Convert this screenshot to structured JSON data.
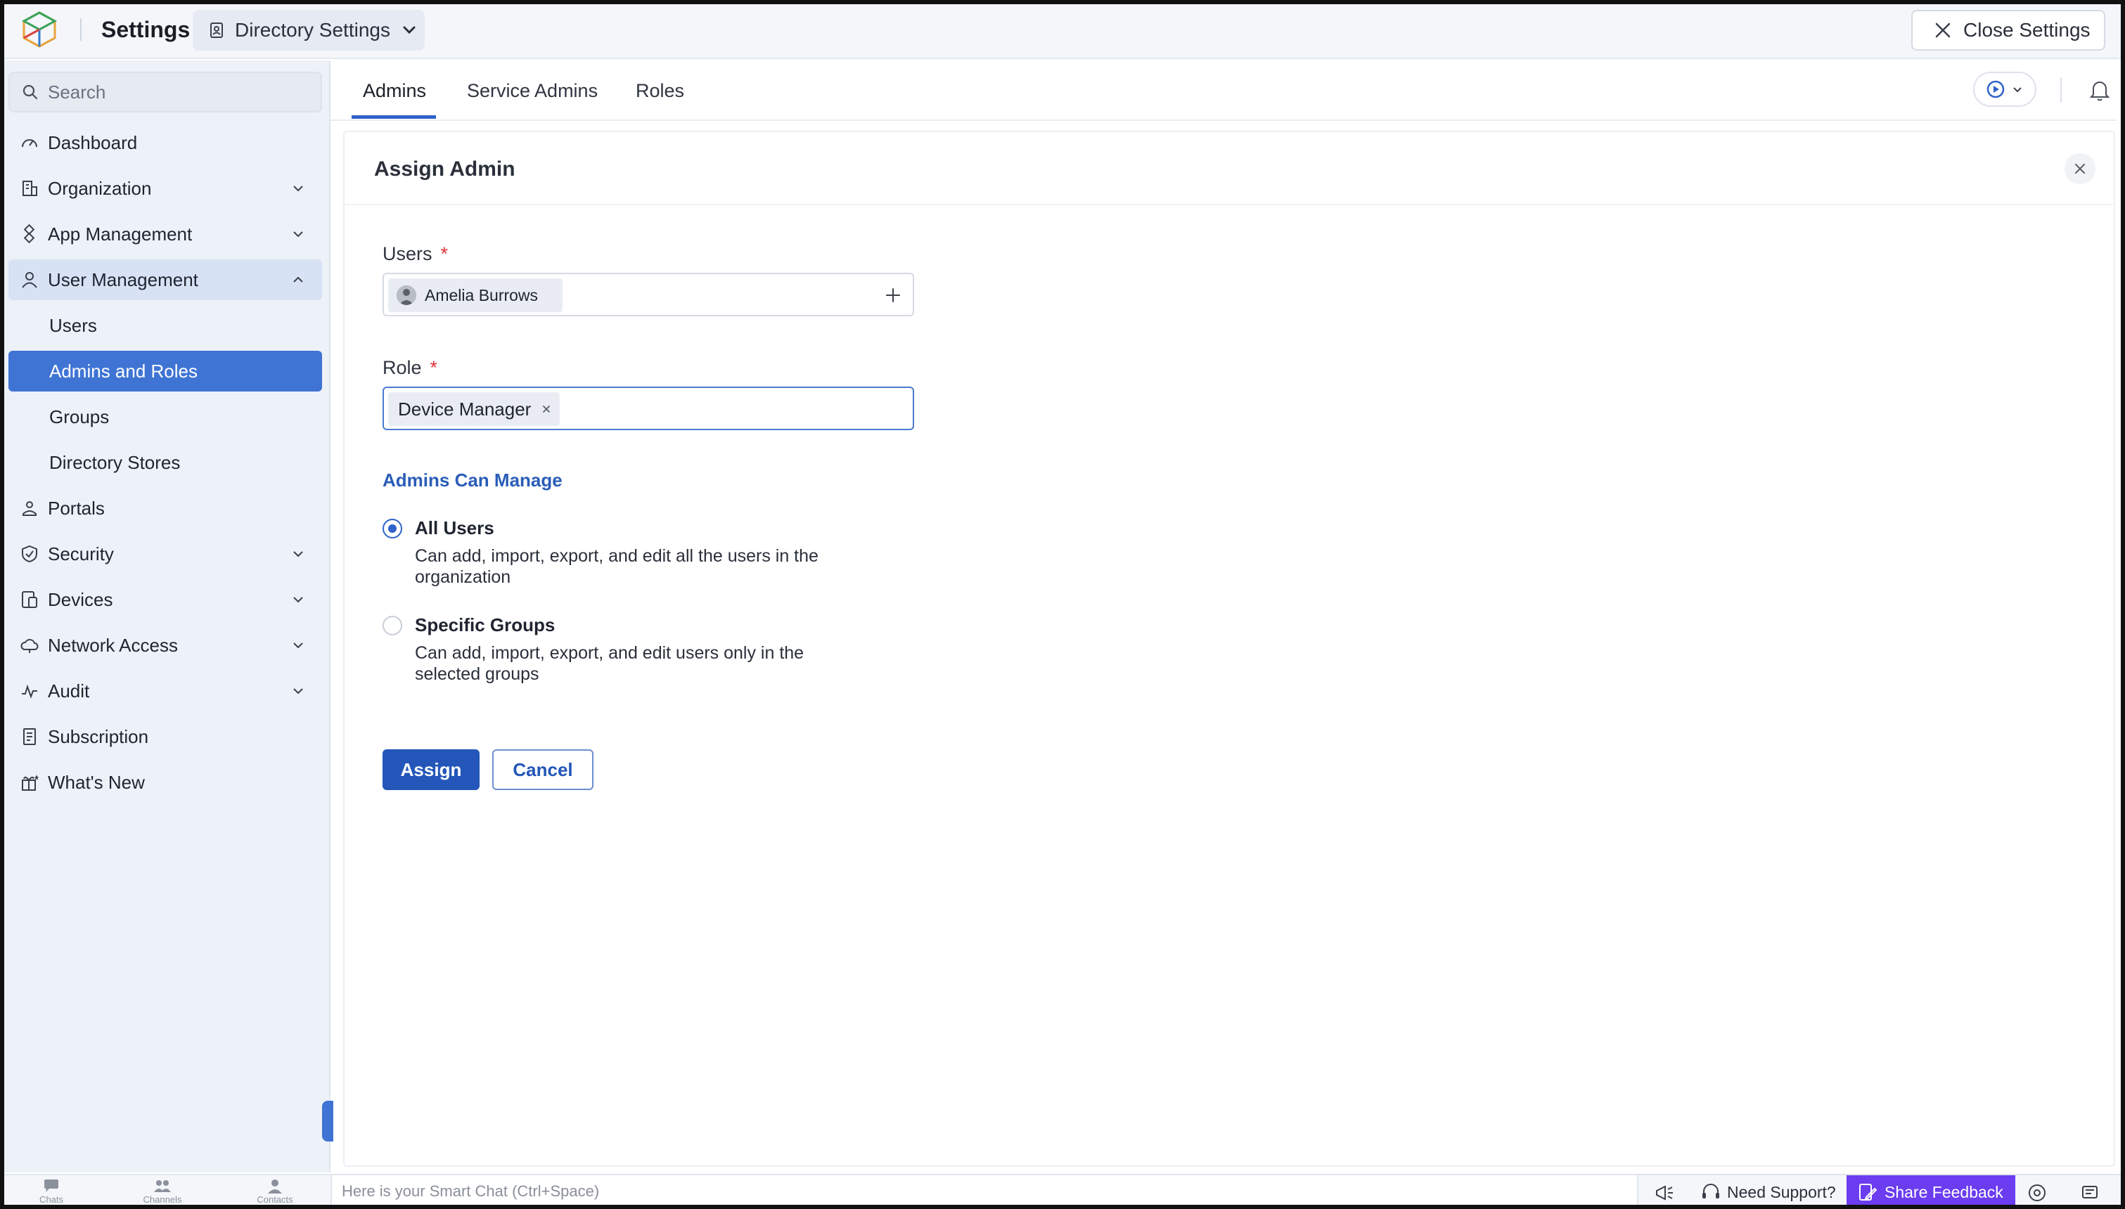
{
  "header": {
    "app_title": "Settings",
    "context_label": "Directory Settings",
    "close_label": "Close Settings"
  },
  "sidebar": {
    "search_placeholder": "Search",
    "items": [
      {
        "label": "Dashboard",
        "icon": "dashboard-icon"
      },
      {
        "label": "Organization",
        "icon": "building-icon",
        "expandable": true
      },
      {
        "label": "App Management",
        "icon": "apps-icon",
        "expandable": true
      },
      {
        "label": "User Management",
        "icon": "user-icon",
        "expandable": true,
        "expanded": true
      },
      {
        "label": "Users",
        "sub": true
      },
      {
        "label": "Admins and Roles",
        "sub": true,
        "selected": true
      },
      {
        "label": "Groups",
        "sub": true
      },
      {
        "label": "Directory Stores",
        "sub": true
      },
      {
        "label": "Portals",
        "icon": "portal-icon"
      },
      {
        "label": "Security",
        "icon": "shield-icon",
        "expandable": true
      },
      {
        "label": "Devices",
        "icon": "devices-icon",
        "expandable": true
      },
      {
        "label": "Network Access",
        "icon": "cloud-icon",
        "expandable": true
      },
      {
        "label": "Audit",
        "icon": "pulse-icon",
        "expandable": true
      },
      {
        "label": "Subscription",
        "icon": "receipt-icon"
      },
      {
        "label": "What's New",
        "icon": "gift-icon"
      }
    ]
  },
  "tabs": [
    {
      "label": "Admins",
      "active": true
    },
    {
      "label": "Service Admins"
    },
    {
      "label": "Roles"
    }
  ],
  "panel": {
    "title": "Assign Admin",
    "users_label": "Users",
    "users_selected": "Amelia Burrows",
    "role_label": "Role",
    "role_selected": "Device Manager",
    "required_mark": "*",
    "section_title": "Admins Can Manage",
    "options": [
      {
        "title": "All Users",
        "desc": "Can add, import, export, and edit all the users in the organization",
        "checked": true
      },
      {
        "title": "Specific Groups",
        "desc": "Can add, import, export, and edit users only in the selected groups",
        "checked": false
      }
    ],
    "assign_label": "Assign",
    "cancel_label": "Cancel"
  },
  "bottombar": {
    "apps": [
      "Chats",
      "Channels",
      "Contacts"
    ],
    "smart_chat_placeholder": "Here is your Smart Chat (Ctrl+Space)",
    "need_support": "Need Support?",
    "share_feedback": "Share Feedback"
  },
  "colors": {
    "accent": "#3f74d4",
    "primary_button": "#2356b8",
    "feedback": "#6b3cf0",
    "required": "#e0333a"
  }
}
